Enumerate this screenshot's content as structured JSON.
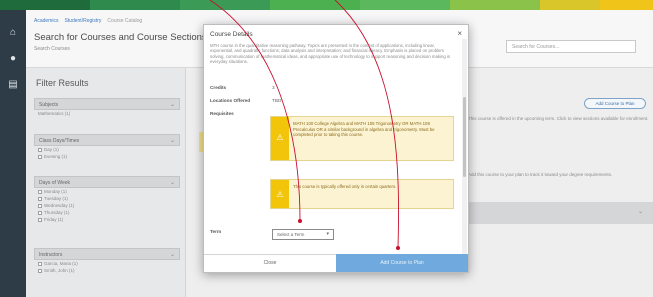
{
  "colors": {
    "rail": "#2d3c47",
    "strip": [
      "#1f6b3c",
      "#2e8b4d",
      "#3a9a56",
      "#4caf50",
      "#5cb85c",
      "#8bc34a",
      "#d9c62a",
      "#f0c419"
    ],
    "accent_blue": "#6fa9dd",
    "warning_yellow": "#f2c40a",
    "annotation_red": "#c8102e"
  },
  "rail": {
    "icons": [
      "home-icon",
      "user-icon",
      "list-icon"
    ]
  },
  "header": {
    "breadcrumbs": [
      "Academics",
      "Student/Registry",
      "Course Catalog"
    ],
    "title": "Search for Courses and Course Sections",
    "subtitle": "Search Courses",
    "search_placeholder": "Search for Courses..."
  },
  "filters": {
    "title": "Filter Results",
    "groups": [
      {
        "label": "Subjects",
        "options": [
          "Mathematics (1)"
        ]
      },
      {
        "label": "Class Days/Times",
        "options": [
          "Day (1)",
          "Evening (1)"
        ]
      },
      {
        "label": "Days of Week",
        "options": [
          "Monday (1)",
          "Tuesday (1)",
          "Wednesday (1)",
          "Thursday (1)",
          "Friday (1)"
        ]
      },
      {
        "label": "Instructors",
        "options": [
          "Garcia, Maria (1)",
          "Smith, John (1)"
        ]
      }
    ]
  },
  "main": {
    "add_button": "Add Course to Plan",
    "right_text_1": "This course is offered in the upcoming term. Click to view sections available for enrollment.",
    "right_text_2": "Add this course to your plan to track it toward your degree requirements."
  },
  "modal": {
    "title": "Course Details",
    "close": "×",
    "description": "MTH course in the quantitative reasoning pathway. Topics are presented in the context of applications, including linear, exponential, and quadratic functions; data analysis and interpretation; and financial literacy. Emphasis is placed on problem solving, communication of mathematical ideas, and appropriate use of technology to support reasoning and decision making in everyday situations.",
    "fields": [
      {
        "label": "Credits",
        "value": "3"
      },
      {
        "label": "Locations Offered",
        "value": "TBD"
      },
      {
        "label": "Requisites",
        "value": ""
      }
    ],
    "warnings": [
      "MATH 100 College Algebra and MATH 105 Trigonometry OR MATH 108 Precalculus OR a similar background in algebra and trigonometry. Must be completed prior to taking this course.",
      "This course is typically offered only in certain quarters."
    ],
    "term_label": "Term",
    "term_select": "Select a Term",
    "close_button": "Close",
    "add_button": "Add Course to Plan"
  }
}
